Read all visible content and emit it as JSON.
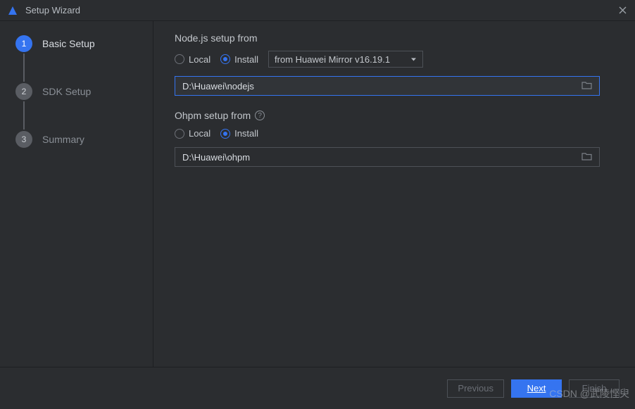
{
  "window": {
    "title": "Setup Wizard"
  },
  "sidebar": {
    "steps": [
      {
        "num": "1",
        "label": "Basic Setup"
      },
      {
        "num": "2",
        "label": "SDK Setup"
      },
      {
        "num": "3",
        "label": "Summary"
      }
    ]
  },
  "nodejs": {
    "section_label": "Node.js setup from",
    "local_label": "Local",
    "install_label": "Install",
    "dropdown_value": "from Huawei Mirror v16.19.1",
    "path": "D:\\Huawei\\nodejs"
  },
  "ohpm": {
    "section_label": "Ohpm setup from",
    "local_label": "Local",
    "install_label": "Install",
    "path": "D:\\Huawei\\ohpm"
  },
  "footer": {
    "previous": "Previous",
    "next": "Next",
    "finish": "Finish"
  },
  "watermark": "CSDN @武陵悭臾"
}
